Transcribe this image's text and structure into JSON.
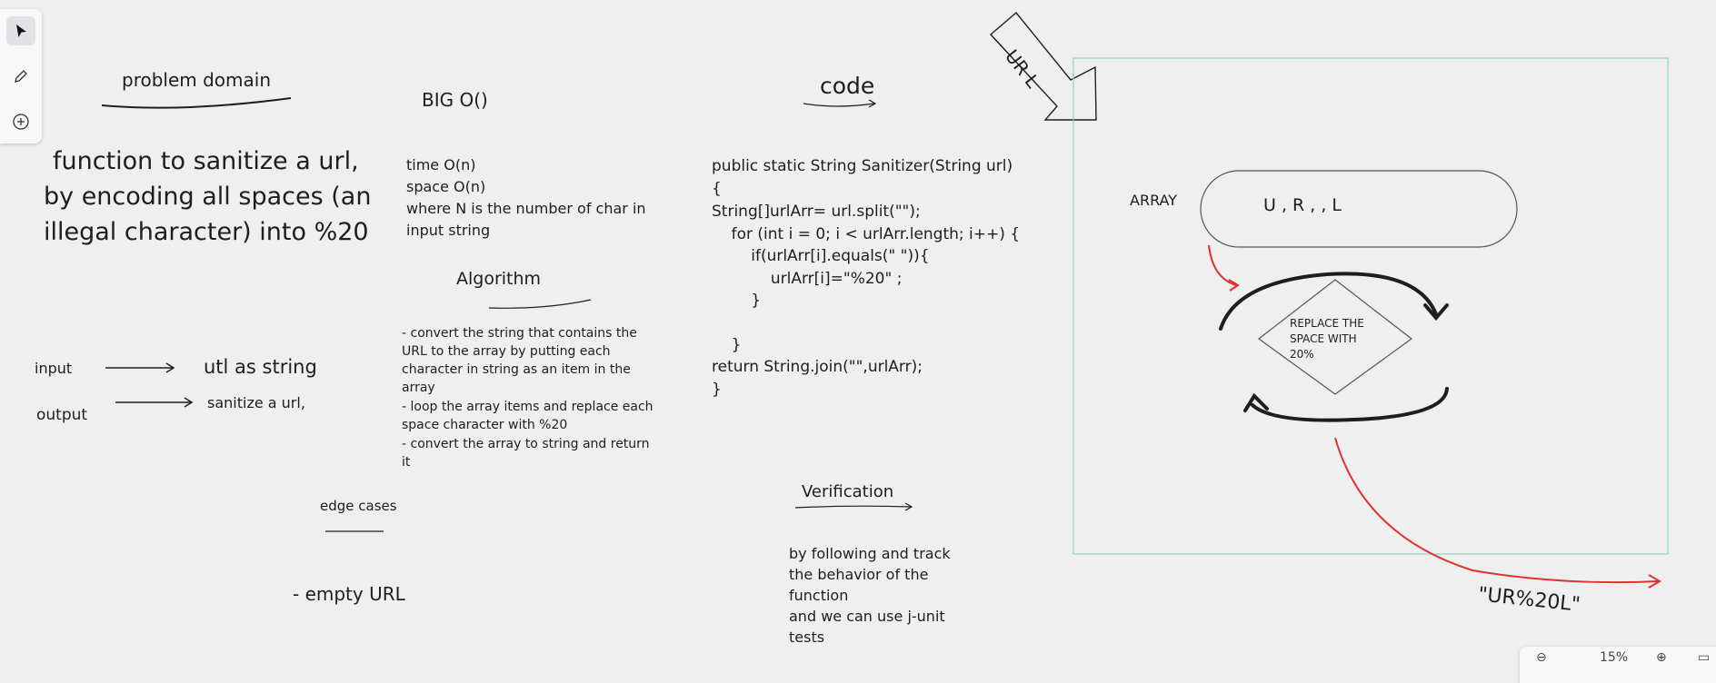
{
  "toolbar": {
    "tools": [
      {
        "name": "select-tool",
        "icon": "pointer-icon"
      },
      {
        "name": "pen-tool",
        "icon": "pen-icon"
      },
      {
        "name": "add-tool",
        "icon": "plus-circle-icon"
      }
    ]
  },
  "canvas": {
    "problem_domain": {
      "heading": "problem domain",
      "description": [
        "function to sanitize a url,",
        "by encoding all spaces (an",
        "illegal character) into %20"
      ]
    },
    "io": {
      "input_label": "input",
      "input_value": "utl as string",
      "output_label": "output",
      "output_value": "sanitize a url,"
    },
    "edge_cases": {
      "heading": "edge cases",
      "item": "- empty URL"
    },
    "big_o": {
      "heading": "BIG O()",
      "lines": [
        "time O(n)",
        "space O(n)",
        "where N is the number of char in",
        "input string"
      ]
    },
    "algorithm": {
      "heading": "Algorithm",
      "lines": [
        "-  convert the string that contains the",
        "URL to the array by putting each",
        "character  in string as an  item in the",
        "array",
        "- loop the array items   and replace each",
        "space character with %20",
        "- convert the array to string and return",
        "it"
      ]
    },
    "code": {
      "heading": "code",
      "lines": [
        "public static String Sanitizer(String url)",
        "{",
        "String[]urlArr= url.split(\"\");",
        "    for (int i = 0; i < urlArr.length; i++) {",
        "        if(urlArr[i].equals(\" \")){",
        "            urlArr[i]=\"%20\" ;",
        "        }",
        "",
        "    }",
        "return String.join(\"\",urlArr);",
        "}"
      ]
    },
    "verification": {
      "heading": "Verification",
      "lines": [
        "by following  and track",
        "the behavior of  the",
        "function",
        "and we can use j-unit",
        "tests"
      ]
    },
    "diagram": {
      "arrow_label": "UR L",
      "array_label": "ARRAY",
      "array_content": "U , R , , L",
      "diamond_text": [
        "REPLACE  THE",
        "SPACE WITH",
        "20%"
      ],
      "result": "\"UR%20L\"",
      "accent_color": "#e03131",
      "frame_color": "#8fd3b8"
    }
  },
  "zoom": {
    "level": "15%"
  }
}
